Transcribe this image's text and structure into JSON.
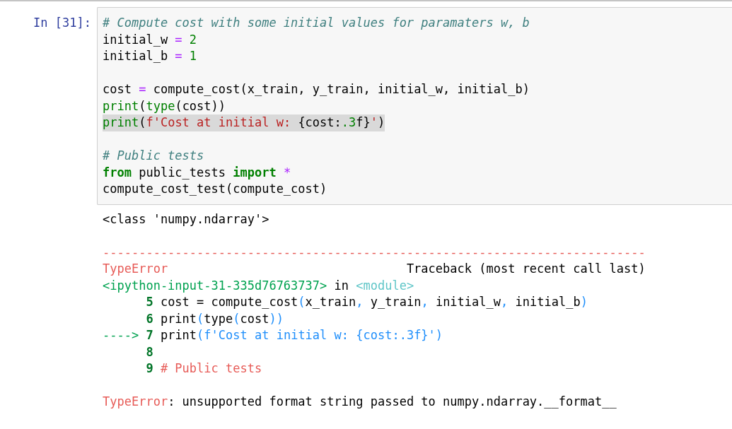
{
  "cell": {
    "prompt": "In [31]:",
    "code_lines": [
      {
        "highlighted": false,
        "tokens": [
          {
            "kind": "comment",
            "text": "# Compute cost with some initial values for paramaters w, b"
          }
        ]
      },
      {
        "highlighted": false,
        "tokens": [
          {
            "kind": "plain",
            "text": "initial_w"
          },
          {
            "kind": "operator",
            "text": " = "
          },
          {
            "kind": "number",
            "text": "2"
          }
        ]
      },
      {
        "highlighted": false,
        "tokens": [
          {
            "kind": "plain",
            "text": "initial_b"
          },
          {
            "kind": "operator",
            "text": " = "
          },
          {
            "kind": "number",
            "text": "1"
          }
        ]
      },
      {
        "highlighted": false,
        "gap_before": true,
        "tokens": [
          {
            "kind": "plain",
            "text": "cost"
          },
          {
            "kind": "operator",
            "text": " = "
          },
          {
            "kind": "plain",
            "text": "compute_cost(x_train, y_train, initial_w, initial_b)"
          }
        ]
      },
      {
        "highlighted": false,
        "tokens": [
          {
            "kind": "builtin",
            "text": "print"
          },
          {
            "kind": "plain",
            "text": "("
          },
          {
            "kind": "builtin",
            "text": "type"
          },
          {
            "kind": "plain",
            "text": "(cost))"
          }
        ]
      },
      {
        "highlighted": true,
        "tokens": [
          {
            "kind": "builtin",
            "text": "print"
          },
          {
            "kind": "plain",
            "text": "("
          },
          {
            "kind": "string",
            "text": "f'Cost at initial w: "
          },
          {
            "kind": "plain",
            "text": "{cost:"
          },
          {
            "kind": "number",
            "text": ".3"
          },
          {
            "kind": "plain",
            "text": "f}"
          },
          {
            "kind": "string",
            "text": "'"
          },
          {
            "kind": "plain",
            "text": ")"
          }
        ]
      },
      {
        "highlighted": false,
        "gap_before": true,
        "tokens": [
          {
            "kind": "comment",
            "text": "# Public tests"
          }
        ]
      },
      {
        "highlighted": false,
        "tokens": [
          {
            "kind": "keyword",
            "text": "from"
          },
          {
            "kind": "plain",
            "text": " public_tests "
          },
          {
            "kind": "keyword",
            "text": "import"
          },
          {
            "kind": "operator",
            "text": " *"
          }
        ]
      },
      {
        "highlighted": false,
        "tokens": [
          {
            "kind": "plain",
            "text": "compute_cost_test(compute_cost)"
          }
        ]
      }
    ]
  },
  "output_lines": [
    {
      "tokens": [
        {
          "kind": "plain",
          "text": "<class 'numpy.ndarray'>"
        }
      ]
    },
    {
      "gap_before": true,
      "tokens": [
        {
          "kind": "error",
          "text": "---------------------------------------------------------------------------"
        }
      ]
    },
    {
      "tokens": [
        {
          "kind": "error",
          "text": "TypeError"
        },
        {
          "kind": "plain",
          "text": "                                 Traceback (most recent call last)"
        }
      ]
    },
    {
      "tokens": [
        {
          "kind": "path",
          "text": "<ipython-input-31-335d76763737>"
        },
        {
          "kind": "plain",
          "text": " in "
        },
        {
          "kind": "module",
          "text": "<module>"
        }
      ]
    },
    {
      "tokens": [
        {
          "kind": "lineno",
          "text": "      5"
        },
        {
          "kind": "plain",
          "text": " cost = compute_cost"
        },
        {
          "kind": "punct",
          "text": "("
        },
        {
          "kind": "plain",
          "text": "x_train"
        },
        {
          "kind": "punct",
          "text": ","
        },
        {
          "kind": "plain",
          "text": " y_train"
        },
        {
          "kind": "punct",
          "text": ","
        },
        {
          "kind": "plain",
          "text": " initial_w"
        },
        {
          "kind": "punct",
          "text": ","
        },
        {
          "kind": "plain",
          "text": " initial_b"
        },
        {
          "kind": "punct",
          "text": ")"
        }
      ]
    },
    {
      "tokens": [
        {
          "kind": "lineno",
          "text": "      6"
        },
        {
          "kind": "plain",
          "text": " print"
        },
        {
          "kind": "punct",
          "text": "("
        },
        {
          "kind": "plain",
          "text": "type"
        },
        {
          "kind": "punct",
          "text": "("
        },
        {
          "kind": "plain",
          "text": "cost"
        },
        {
          "kind": "punct",
          "text": "))"
        }
      ]
    },
    {
      "tokens": [
        {
          "kind": "arrow",
          "text": "---->"
        },
        {
          "kind": "lineno",
          "text": " 7"
        },
        {
          "kind": "plain",
          "text": " print"
        },
        {
          "kind": "punct",
          "text": "(f'Cost at initial w: {cost:.3f}')"
        }
      ]
    },
    {
      "tokens": [
        {
          "kind": "lineno",
          "text": "      8"
        }
      ]
    },
    {
      "tokens": [
        {
          "kind": "lineno",
          "text": "      9"
        },
        {
          "kind": "error",
          "text": " # Public tests"
        }
      ]
    },
    {
      "gap_before": true,
      "tokens": [
        {
          "kind": "error",
          "text": "TypeError"
        },
        {
          "kind": "plain",
          "text": ": unsupported format string passed to numpy.ndarray.__format__"
        }
      ]
    }
  ]
}
